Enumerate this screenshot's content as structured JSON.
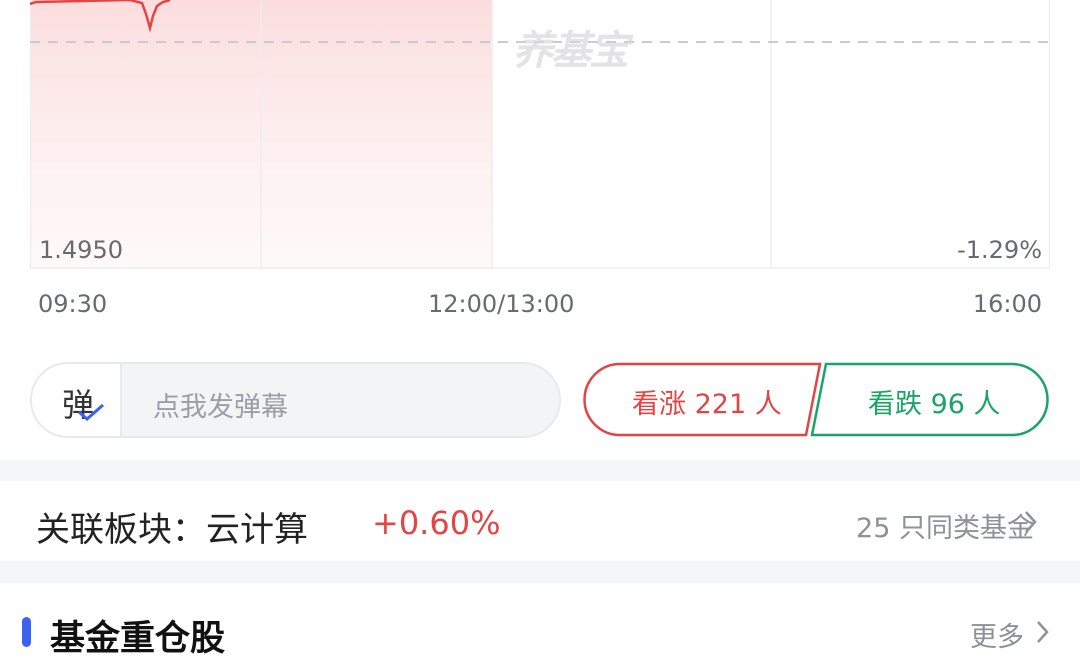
{
  "chart": {
    "low_price": "1.4950",
    "low_pct": "-1.29%",
    "watermark": "养基宝",
    "time_open": "09:30",
    "time_mid": "12:00/13:00",
    "time_close": "16:00",
    "line_color": "#e34545",
    "grid_color": "#ededf0"
  },
  "danmaku": {
    "icon_char": "弹",
    "placeholder": "点我发弹幕"
  },
  "vote": {
    "up_label": "看涨 221 人",
    "down_label": "看跌 96 人",
    "up_color": "#e34545",
    "down_color": "#1aa566"
  },
  "sector": {
    "title": "关联板块：云计算",
    "change": "+0.60%",
    "link": "25 只同类基金"
  },
  "holdings": {
    "title": "基金重仓股",
    "more": "更多",
    "accent": "#3a63f0"
  }
}
